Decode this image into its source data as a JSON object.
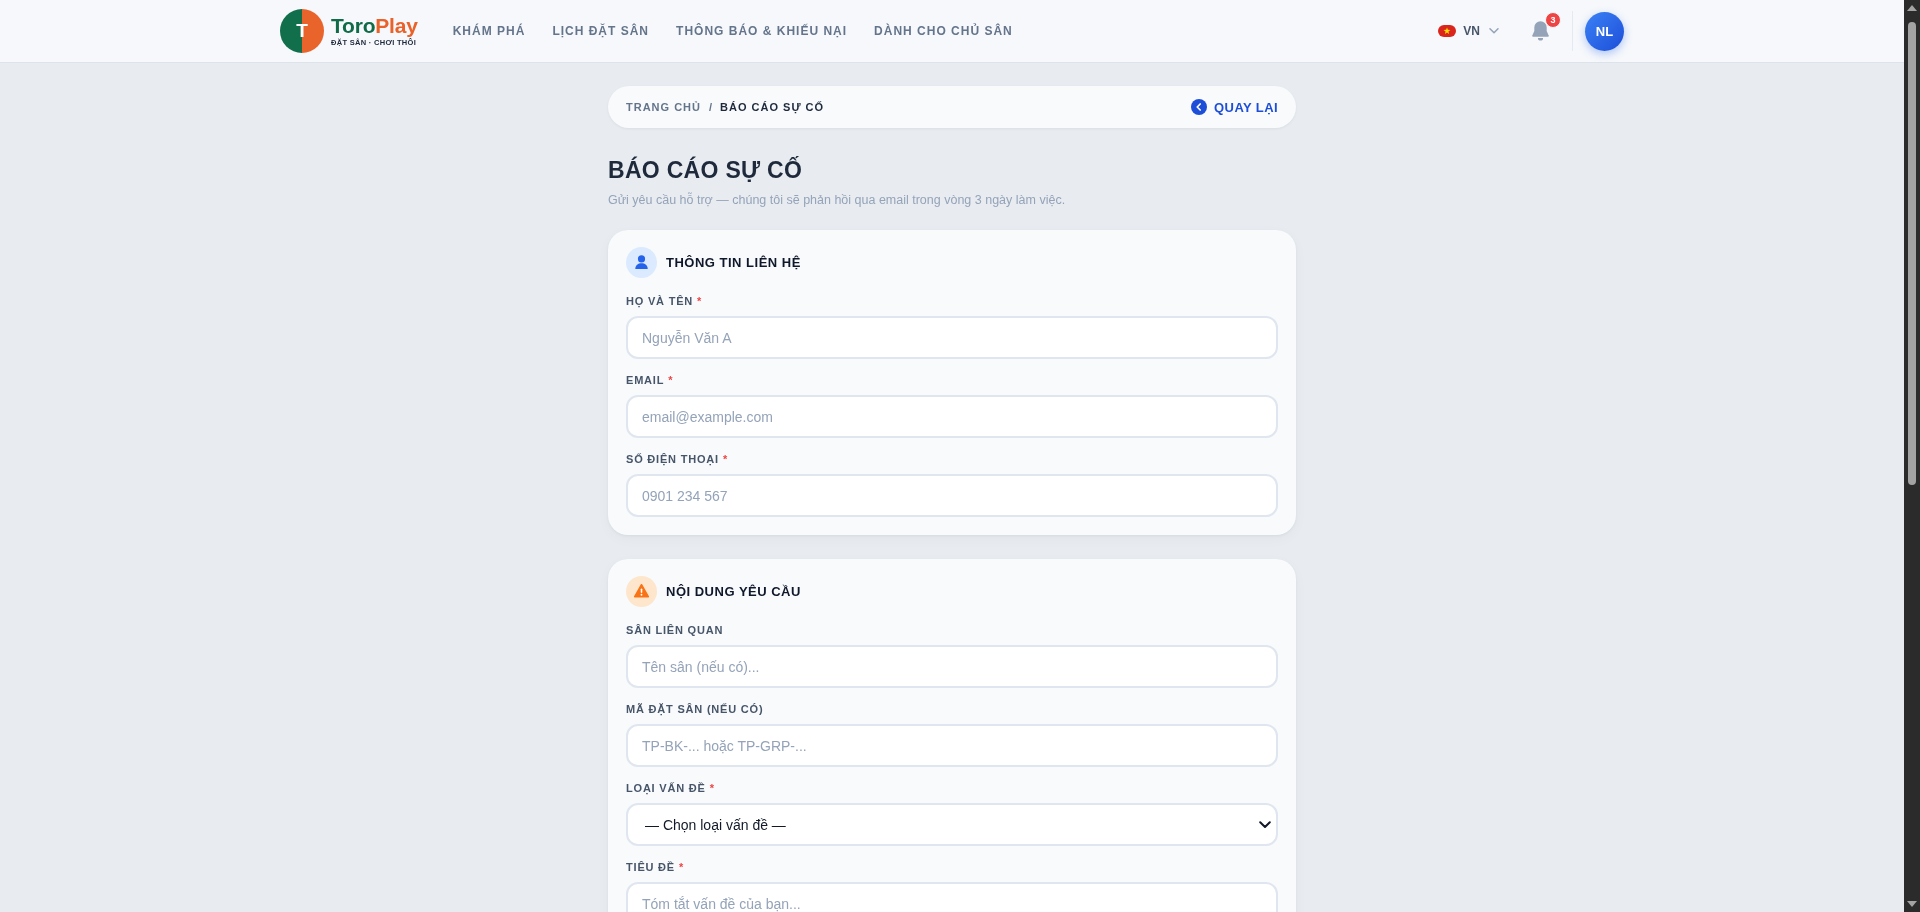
{
  "header": {
    "brand": {
      "mark": "T",
      "name_parts": [
        "Toro",
        "Play"
      ],
      "tagline": "ĐẶT SÂN · CHƠI THÔI"
    },
    "nav": [
      {
        "label": "KHÁM PHÁ",
        "selected": false
      },
      {
        "label": "LỊCH ĐẶT SÂN",
        "selected": false
      },
      {
        "label": "THÔNG BÁO & KHIẾU NẠI",
        "selected": false
      },
      {
        "label": "DÀNH CHO CHỦ SÂN",
        "selected": false
      }
    ],
    "language": {
      "code": "VN"
    },
    "notifications": {
      "badge": "3"
    },
    "avatar": {
      "initials": "NL"
    }
  },
  "breadcrumb": {
    "items": [
      {
        "label": "TRANG CHỦ",
        "current": false
      },
      {
        "label": "BÁO CÁO SỰ CỐ",
        "current": true
      }
    ],
    "separator": "/",
    "back_button": "QUAY LẠI"
  },
  "page": {
    "title": "BÁO CÁO SỰ CỐ",
    "subtitle": "Gửi yêu cầu hỗ trợ — chúng tôi sẽ phản hồi qua email trong vòng 3 ngày làm việc."
  },
  "sections": [
    {
      "kind": "contact",
      "title": "THÔNG TIN LIÊN HỆ",
      "fields": [
        {
          "kind": "input",
          "label": "HỌ VÀ TÊN",
          "required_mark": "*",
          "placeholder": "Nguyễn Văn A"
        },
        {
          "kind": "input",
          "label": "EMAIL",
          "required_mark": "*",
          "placeholder": "email@example.com"
        },
        {
          "kind": "input",
          "label": "SỐ ĐIỆN THOẠI",
          "required_mark": "*",
          "placeholder": "0901 234 567"
        }
      ]
    },
    {
      "kind": "issue",
      "title": "NỘI DUNG YÊU CẦU",
      "fields": [
        {
          "kind": "input",
          "label": "SÂN LIÊN QUAN",
          "placeholder": "Tên sân (nếu có)..."
        },
        {
          "kind": "input",
          "label": "MÃ ĐẶT SÂN (NẾU CÓ)",
          "placeholder": "TP-BK-... hoặc TP-GRP-..."
        },
        {
          "kind": "select",
          "label": "LOẠI VẤN ĐỀ",
          "required_mark": "*",
          "value": "— Chọn loại vấn đề —"
        },
        {
          "kind": "input",
          "label": "TIÊU ĐỀ",
          "required_mark": "*",
          "placeholder": "Tóm tắt vấn đề của bạn..."
        }
      ]
    }
  ]
}
